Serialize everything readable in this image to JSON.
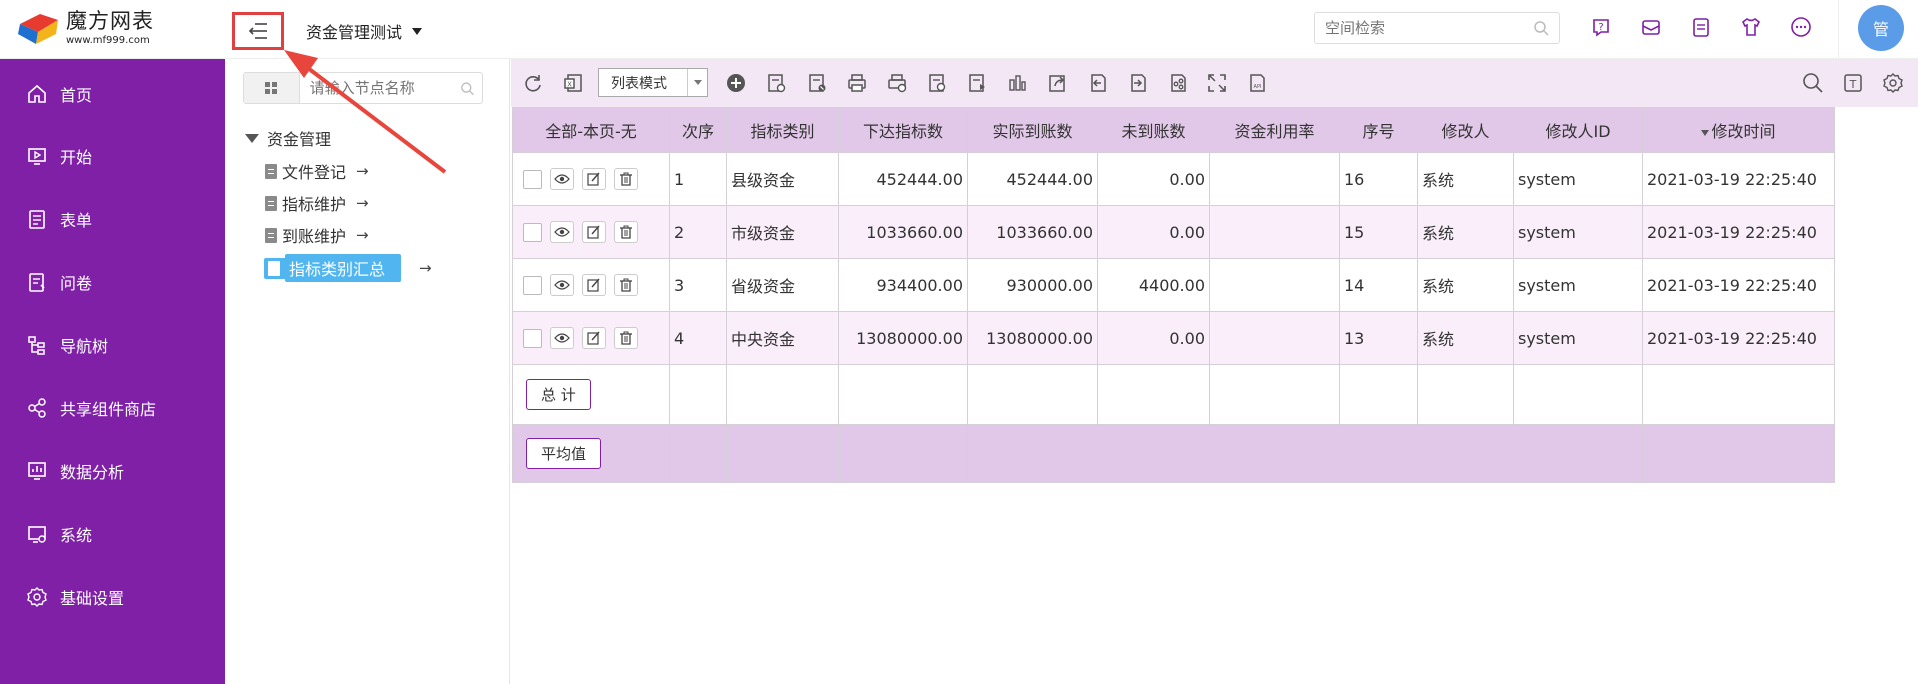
{
  "header": {
    "logo_name": "魔方网表",
    "logo_url": "www.mf999.com",
    "space_title": "资金管理测试",
    "search_placeholder": "空间检索",
    "avatar_text": "管"
  },
  "sidenav": {
    "items": [
      {
        "label": "首页",
        "icon": "home-icon"
      },
      {
        "label": "开始",
        "icon": "monitor-play-icon"
      },
      {
        "label": "表单",
        "icon": "form-icon"
      },
      {
        "label": "问卷",
        "icon": "questionnaire-icon"
      },
      {
        "label": "导航树",
        "icon": "tree-icon"
      },
      {
        "label": "共享组件商店",
        "icon": "share-icon"
      },
      {
        "label": "数据分析",
        "icon": "chart-icon"
      },
      {
        "label": "系统",
        "icon": "system-icon"
      },
      {
        "label": "基础设置",
        "icon": "gear-icon"
      }
    ]
  },
  "tree": {
    "search_placeholder": "请输入节点名称",
    "root": "资金管理",
    "nodes": [
      "文件登记",
      "指标维护",
      "到账维护",
      "指标类别汇总"
    ],
    "arrow": "→"
  },
  "toolbar": {
    "mode": "列表模式"
  },
  "table": {
    "headers": [
      "全部-本页-无",
      "次序",
      "指标类别",
      "下达指标数",
      "实际到账数",
      "未到账数",
      "资金利用率",
      "序号",
      "修改人",
      "修改人ID",
      "修改时间"
    ],
    "rows": [
      {
        "order": "1",
        "category": "县级资金",
        "issued": "452444.00",
        "received": "452444.00",
        "pending": "0.00",
        "rate": "",
        "seq": "16",
        "editor": "系统",
        "editor_id": "system",
        "time": "2021-03-19 22:25:40"
      },
      {
        "order": "2",
        "category": "市级资金",
        "issued": "1033660.00",
        "received": "1033660.00",
        "pending": "0.00",
        "rate": "",
        "seq": "15",
        "editor": "系统",
        "editor_id": "system",
        "time": "2021-03-19 22:25:40"
      },
      {
        "order": "3",
        "category": "省级资金",
        "issued": "934400.00",
        "received": "930000.00",
        "pending": "4400.00",
        "rate": "",
        "seq": "14",
        "editor": "系统",
        "editor_id": "system",
        "time": "2021-03-19 22:25:40"
      },
      {
        "order": "4",
        "category": "中央资金",
        "issued": "13080000.00",
        "received": "13080000.00",
        "pending": "0.00",
        "rate": "",
        "seq": "13",
        "editor": "系统",
        "editor_id": "system",
        "time": "2021-03-19 22:25:40"
      }
    ],
    "total_label": "总 计",
    "avg_label": "平均值"
  },
  "colors": {
    "nav_bg": "#7f20a7",
    "toolbar_bg": "#f3e6f5",
    "header_bg": "#e2c8e8",
    "highlight": "#e04040",
    "active_node": "#51b6f0"
  }
}
